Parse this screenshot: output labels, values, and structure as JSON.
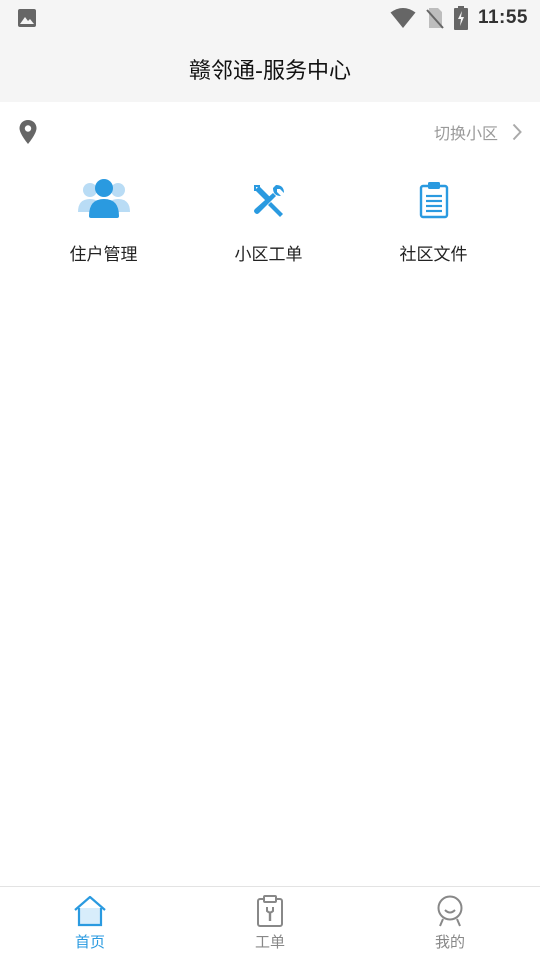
{
  "status_bar": {
    "time": "11:55"
  },
  "header": {
    "title": "赣邻通-服务中心"
  },
  "location": {
    "switch_label": "切换小区"
  },
  "grid": [
    {
      "label": "住户管理",
      "icon": "residents-icon"
    },
    {
      "label": "小区工单",
      "icon": "tools-icon"
    },
    {
      "label": "社区文件",
      "icon": "clipboard-icon"
    }
  ],
  "tabs": [
    {
      "label": "首页",
      "icon": "home-icon",
      "active": true
    },
    {
      "label": "工单",
      "icon": "work-order-icon",
      "active": false
    },
    {
      "label": "我的",
      "icon": "profile-icon",
      "active": false
    }
  ],
  "colors": {
    "accent": "#2a9ae0",
    "icon_light": "#b9dcf5",
    "muted": "#9a9a9a"
  }
}
